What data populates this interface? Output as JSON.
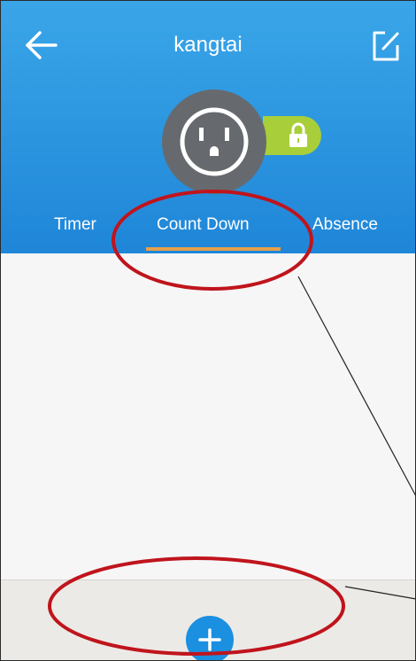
{
  "header": {
    "title": "kangtai",
    "back_icon": "back-arrow-icon",
    "edit_icon": "edit-icon"
  },
  "device": {
    "outlet_icon": "power-outlet-icon",
    "lock_icon": "lock-icon"
  },
  "tabs": [
    {
      "label": "Timer"
    },
    {
      "label": "Count Down",
      "selected": true
    },
    {
      "label": "Absence"
    }
  ],
  "footer": {
    "add_icon": "plus-icon"
  },
  "colors": {
    "header_blue": "#2196e6",
    "tab_indicator": "#e7a04a",
    "annotation_red": "#c0141c",
    "lock_green": "#a8cf3a",
    "add_button_blue": "#1b8fe0"
  }
}
